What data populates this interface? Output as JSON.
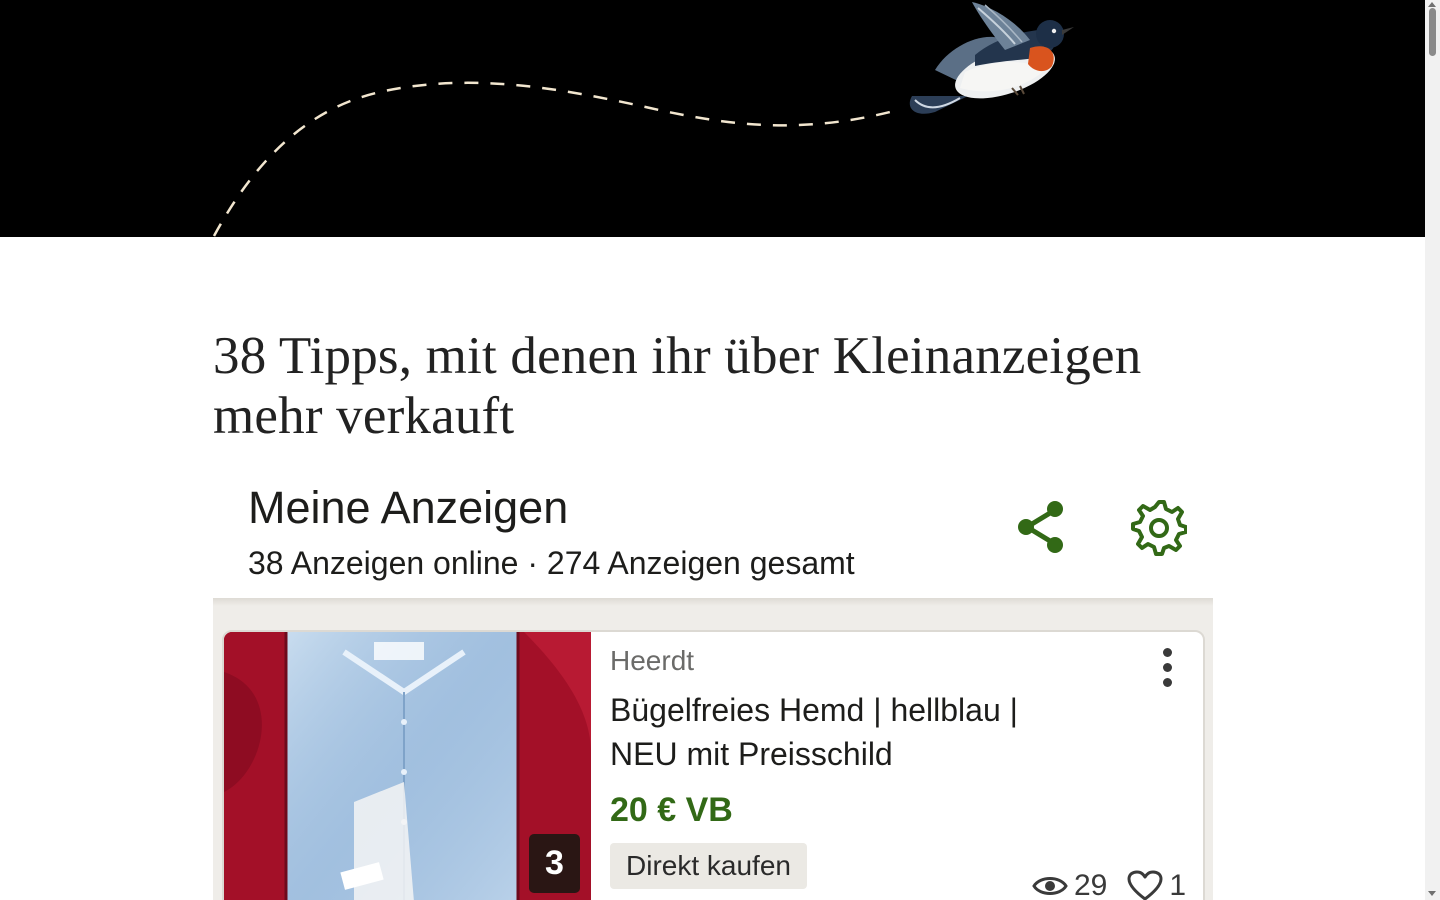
{
  "article": {
    "title": "38 Tipps, mit denen ihr über Kleinanzeigen mehr verkauft"
  },
  "app": {
    "title": "Meine Anzeigen",
    "subtitle": "38 Anzeigen online · 274 Anzeigen gesamt",
    "accent_color": "#326916",
    "share_icon": "share-icon",
    "settings_icon": "gear-icon"
  },
  "listing": {
    "location": "Heerdt",
    "title": "Bügelfreies Hemd | hellblau | NEU mit Preisschild",
    "price": "20 € VB",
    "badge": "Direkt kaufen",
    "image_count": "3",
    "views": "29",
    "likes": "1"
  }
}
